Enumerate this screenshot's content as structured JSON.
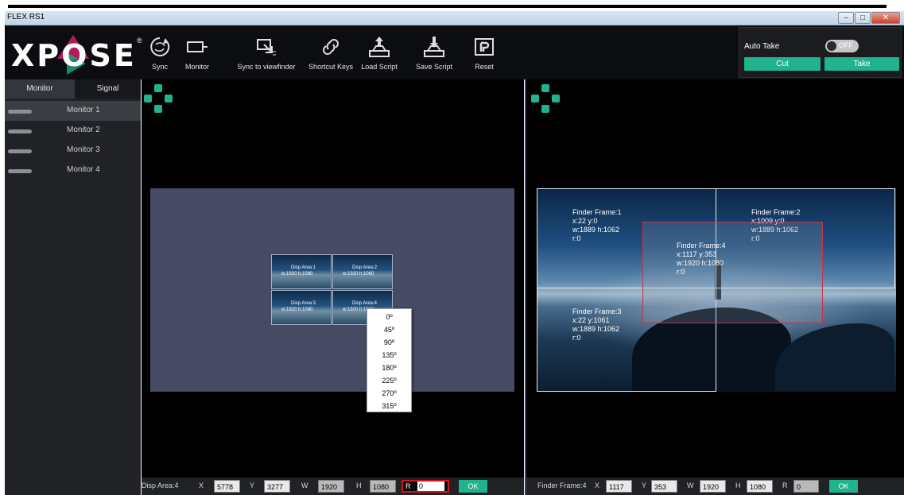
{
  "window": {
    "title": "FLEX RS1",
    "min_icon": "minimize-icon",
    "max_icon": "maximize-icon",
    "close_icon": "close-icon"
  },
  "logo": {
    "text": "XPOSE",
    "mark": "®"
  },
  "toolbar": {
    "items": [
      {
        "label": "Sync",
        "icon": "sync-icon"
      },
      {
        "label": "Monitor",
        "icon": "monitor-icon"
      },
      {
        "label": "Sync to viewfinder",
        "icon": "viewfinder-icon"
      },
      {
        "label": "Shortcut Keys",
        "icon": "link-icon"
      },
      {
        "label": "Load Script",
        "icon": "upload-icon"
      },
      {
        "label": "Save Script",
        "icon": "download-icon"
      },
      {
        "label": "Reset",
        "icon": "reset-icon"
      }
    ]
  },
  "autotake": {
    "label": "Auto Take",
    "toggle": "OFF",
    "cut": "Cut",
    "take": "Take"
  },
  "sidebar": {
    "tabs": [
      "Monitor",
      "Signal"
    ],
    "monitors": [
      "Monitor 1",
      "Monitor 2",
      "Monitor 3",
      "Monitor 4"
    ]
  },
  "disp_areas": [
    {
      "title": "Disp Area:1",
      "size": "w:1920 h:1080"
    },
    {
      "title": "Disp Area:2",
      "size": "w:1920 h:1080"
    },
    {
      "title": "Disp Area:3",
      "size": "w:1920 h:1080"
    },
    {
      "title": "Disp Area:4",
      "size": "w:1920 h:1080"
    }
  ],
  "rotation_menu": [
    "0º",
    "45º",
    "90º",
    "135º",
    "180º",
    "225º",
    "270º",
    "315º"
  ],
  "finder_frames": [
    {
      "title": "Finder Frame:1",
      "pos": "x:22  y:0",
      "size": "w:1889  h:1062",
      "rot": "r:0"
    },
    {
      "title": "Finder Frame:2",
      "pos": "x:1009  y:0",
      "size": "w:1889  h:1062",
      "rot": "r:0"
    },
    {
      "title": "Finder Frame:3",
      "pos": "x:22  y:1061",
      "size": "w:1889  h:1062",
      "rot": "r:0"
    },
    {
      "title": "Finder Frame:4",
      "pos": "x:1117  y:353",
      "size": "w:1920  h:1080",
      "rot": "r:0"
    }
  ],
  "left_status": {
    "label": "Disp Area:4",
    "x_label": "X",
    "x": "5778",
    "y_label": "Y",
    "y": "3277",
    "w_label": "W",
    "w": "1920",
    "h_label": "H",
    "h": "1080",
    "r_label": "R",
    "r": "0",
    "ok": "OK"
  },
  "right_status": {
    "label": "Finder Frame:4",
    "x_label": "X",
    "x": "1117",
    "y_label": "Y",
    "y": "353",
    "w_label": "W",
    "w": "1920",
    "h_label": "H",
    "h": "1080",
    "r_label": "R",
    "r": "0",
    "ok": "OK"
  },
  "colors": {
    "accent": "#21b38d",
    "selection": "#d4141f",
    "background": "#000000",
    "panel": "#202226"
  }
}
